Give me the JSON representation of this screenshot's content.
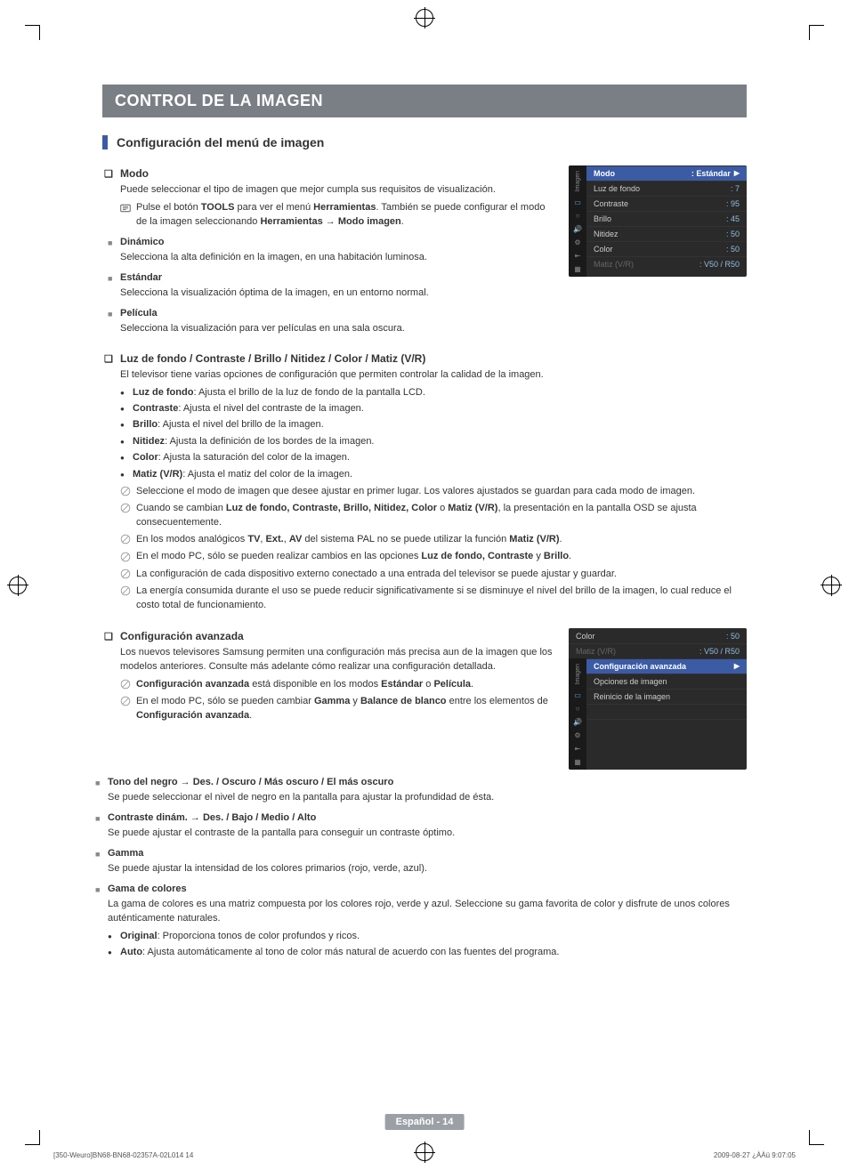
{
  "banner": "CONTROL DE LA IMAGEN",
  "section_title": "Configuración del menú de imagen",
  "modo": {
    "heading": "Modo",
    "intro": "Puede seleccionar el tipo de imagen que mejor cumpla sus requisitos de visualización.",
    "tools_pre": "Pulse el botón ",
    "tools_b1": "TOOLS",
    "tools_mid1": " para ver el menú ",
    "tools_b2": "Herramientas",
    "tools_mid2": ". También se puede configurar el modo de la imagen seleccionando ",
    "tools_b3": "Herramientas → Modo imagen",
    "tools_end": ".",
    "items": [
      {
        "title": "Dinámico",
        "text": "Selecciona la alta definición en la imagen, en una habitación luminosa."
      },
      {
        "title": "Estándar",
        "text": "Selecciona la visualización óptima de la imagen, en un entorno normal."
      },
      {
        "title": "Película",
        "text": "Selecciona la visualización para ver películas en una sala oscura."
      }
    ]
  },
  "luz": {
    "heading": "Luz de fondo / Contraste / Brillo / Nitidez / Color / Matiz (V/R)",
    "intro": "El televisor tiene varias opciones de configuración que permiten controlar la calidad de la imagen.",
    "bullets": [
      {
        "b": "Luz de fondo",
        "t": ": Ajusta el brillo de la luz de fondo de la pantalla LCD."
      },
      {
        "b": "Contraste",
        "t": ": Ajusta el nivel del contraste de la imagen."
      },
      {
        "b": "Brillo",
        "t": ": Ajusta el nivel del brillo de la imagen."
      },
      {
        "b": "Nitidez",
        "t": ": Ajusta la definición de los bordes de la imagen."
      },
      {
        "b": "Color",
        "t": ": Ajusta la saturación del color de la imagen."
      },
      {
        "b": "Matiz (V/R)",
        "t": ": Ajusta el matiz del color de la imagen."
      }
    ],
    "notes": {
      "n0": "Seleccione el modo de imagen que desee ajustar en primer lugar. Los valores ajustados se guardan para cada modo de imagen.",
      "n1_pre": "Cuando se cambian ",
      "n1_b1": "Luz de fondo, Contraste, Brillo, Nitidez, Color",
      "n1_mid": " o ",
      "n1_b2": "Matiz (V/R)",
      "n1_end": ", la presentación en la pantalla OSD se ajusta consecuentemente.",
      "n2_pre": "En los modos analógicos ",
      "n2_b1": "TV",
      "n2_c1": ", ",
      "n2_b2": "Ext.",
      "n2_c2": ", ",
      "n2_b3": "AV",
      "n2_mid": " del sistema PAL no se puede utilizar la función ",
      "n2_b4": "Matiz (V/R)",
      "n2_end": ".",
      "n3_pre": "En el modo PC, sólo se pueden realizar cambios en las opciones ",
      "n3_b1": "Luz de fondo, Contraste",
      "n3_mid": " y ",
      "n3_b2": "Brillo",
      "n3_end": ".",
      "n4": "La configuración de cada dispositivo externo conectado a una entrada del televisor se puede ajustar y guardar.",
      "n5": "La energía consumida durante el uso se puede reducir significativamente si se disminuye el nivel del brillo de la imagen, lo cual reduce el costo total de funcionamiento."
    }
  },
  "avanzada": {
    "heading": "Configuración avanzada",
    "intro": "Los nuevos televisores Samsung permiten una configuración más precisa aun de la imagen que los modelos anteriores. Consulte más adelante cómo realizar una configuración detallada.",
    "notes": {
      "n0_b1": "Configuración avanzada",
      "n0_mid": " está disponible en los modos ",
      "n0_b2": "Estándar",
      "n0_o": " o ",
      "n0_b3": "Película",
      "n0_end": ".",
      "n1_pre": "En el modo PC, sólo se pueden cambiar ",
      "n1_b1": "Gamma",
      "n1_mid": " y ",
      "n1_b2": "Balance de blanco",
      "n1_mid2": " entre los elementos de ",
      "n1_b3": "Configuración avanzada",
      "n1_end": "."
    },
    "subs": [
      {
        "title": "Tono del negro → Des. / Oscuro / Más oscuro / El más oscuro",
        "text": "Se puede seleccionar el nivel de negro en la pantalla para ajustar la profundidad de ésta."
      },
      {
        "title": "Contraste dinám. → Des. / Bajo / Medio / Alto",
        "text": "Se puede ajustar el contraste de la pantalla para conseguir un contraste óptimo."
      },
      {
        "title": "Gamma",
        "text": "Se puede ajustar la intensidad de los colores primarios (rojo, verde, azul)."
      }
    ],
    "gama": {
      "title": "Gama de colores",
      "text": "La gama de colores es una matriz compuesta por los colores rojo, verde y azul. Seleccione su gama favorita de color y disfrute de unos colores auténticamente naturales.",
      "bullets": [
        {
          "b": "Original",
          "t": ": Proporciona tonos de color profundos y ricos."
        },
        {
          "b": "Auto",
          "t": ": Ajusta automáticamente al tono de color más natural de acuerdo con las fuentes del programa."
        }
      ]
    }
  },
  "osd1": {
    "side_label": "Imagen",
    "rows": [
      {
        "label": "Modo",
        "val": ": Estándar",
        "highlight": true,
        "arrow": "▶"
      },
      {
        "label": "Luz de fondo",
        "val": ": 7"
      },
      {
        "label": "Contraste",
        "val": ": 95"
      },
      {
        "label": "Brillo",
        "val": ": 45"
      },
      {
        "label": "Nitidez",
        "val": ": 50"
      },
      {
        "label": "Color",
        "val": ": 50"
      },
      {
        "label": "Matiz (V/R)",
        "val": ": V50 / R50",
        "dim": true
      }
    ]
  },
  "osd2": {
    "side_label": "Imagen",
    "rows_top": [
      {
        "label": "Color",
        "val": ": 50"
      },
      {
        "label": "Matiz (V/R)",
        "val": ": V50 / R50",
        "dim": true
      }
    ],
    "row_hl": {
      "label": "Configuración avanzada",
      "arrow": "▶"
    },
    "rows_bottom": [
      {
        "label": "Opciones de imagen"
      },
      {
        "label": "Reinicio de la imagen"
      }
    ]
  },
  "footer": {
    "page": "Español - 14",
    "left": "[350-Weuro]BN68-BN68-02357A-02L014   14",
    "right": "2009-08-27   ¿ÀÀü 9:07:05"
  }
}
